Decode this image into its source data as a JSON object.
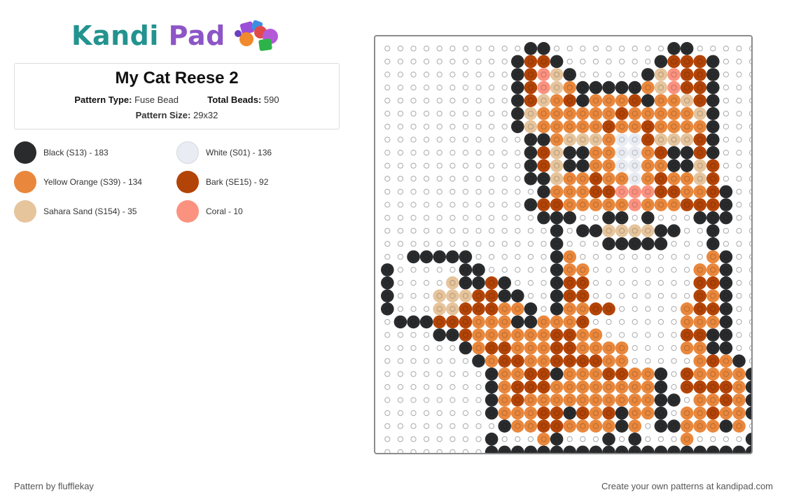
{
  "logo": {
    "part1": "Kandi",
    "part2": "Pad"
  },
  "pattern": {
    "title": "My Cat Reese 2",
    "type_label": "Pattern Type:",
    "type_value": "Fuse Bead",
    "beads_label": "Total Beads:",
    "beads_value": "590",
    "size_label": "Pattern Size:",
    "size_value": "29x32"
  },
  "legend": [
    {
      "label": "Black (S13) - 183",
      "color": "#2a2b2d"
    },
    {
      "label": "White (S01) - 136",
      "color": "#e9ecf2"
    },
    {
      "label": "Yellow Orange (S39) - 134",
      "color": "#e9873c"
    },
    {
      "label": "Bark (SE15) - 92",
      "color": "#b34407"
    },
    {
      "label": "Sahara Sand (S154) - 35",
      "color": "#e6c49c"
    },
    {
      "label": "Coral - 10",
      "color": "#fb927f"
    }
  ],
  "board": {
    "cols": 29,
    "rows": 32,
    "palette": {
      "K": "#2a2b2d",
      "W": "#e9ecf2",
      "O": "#e9873c",
      "B": "#b34407",
      "S": "#e6c49c",
      "C": "#fb927f"
    },
    "grid": [
      "...........KK.........KK.....",
      "..........KBBK.......KBBBK...",
      "..........KBCSK.....KSCBBK...",
      "..........KBCSOKKKKKOSCBBK...",
      "..........KBSOBKOOOBKOOSBK...",
      "..........KSOOOOOOBOOOOOSK...",
      "..........KSOOOOOBOOBOOOOK...",
      "...........KKOSSSOWWBSSSBK...",
      "...........KBSKKOOWWOBKKBK...",
      "...........KBSKKOOWWOOKKSB...",
      "...........KKSOOBOOWOBOOSB...",
      "............KOOOBBCCCBBOOBK..",
      "...........KBBOOOOOCOOOBBBK..",
      "............KKK..KK.K...KKK..",
      ".............K.KKSSSSKK..K...",
      ".............K...KKKKK...K...",
      "..KKKKK......KO..........OK..",
      "K.....KK.....KOO........OOK..",
      "K....SKKBK...KBB........BBK..",
      "K...SSSBBKK..KBB........BOK..",
      "K...SSBBBOOK.KOOBB.....OBBK..",
      ".KKKBBBOOOKKOOOB.......OOOK..",
      "....KKBOOOOOOBBOO......BBKK..",
      "......KOBBOOOBBOOOO....OOKK..",
      ".......KOBBOOBBBBOO.....OBOK.",
      "........KOOBBKOOOBBOOK.BOOOOK",
      "........KOBBBOOOOOOOOK.BBBBOK",
      "........KOBOOOOOOOOOOKK.OOBOK",
      "........KOOOBBKBOBKOOK.OOBOOK",
      ".........KOOBBOOOOKO.KKOOOKO.",
      "........K...OK...K.K...O....K",
      "........KKKKKKKKKKKKKKKKKKKKK"
    ]
  },
  "footer": {
    "left": "Pattern by flufflekay",
    "right": "Create your own patterns at kandipad.com"
  }
}
